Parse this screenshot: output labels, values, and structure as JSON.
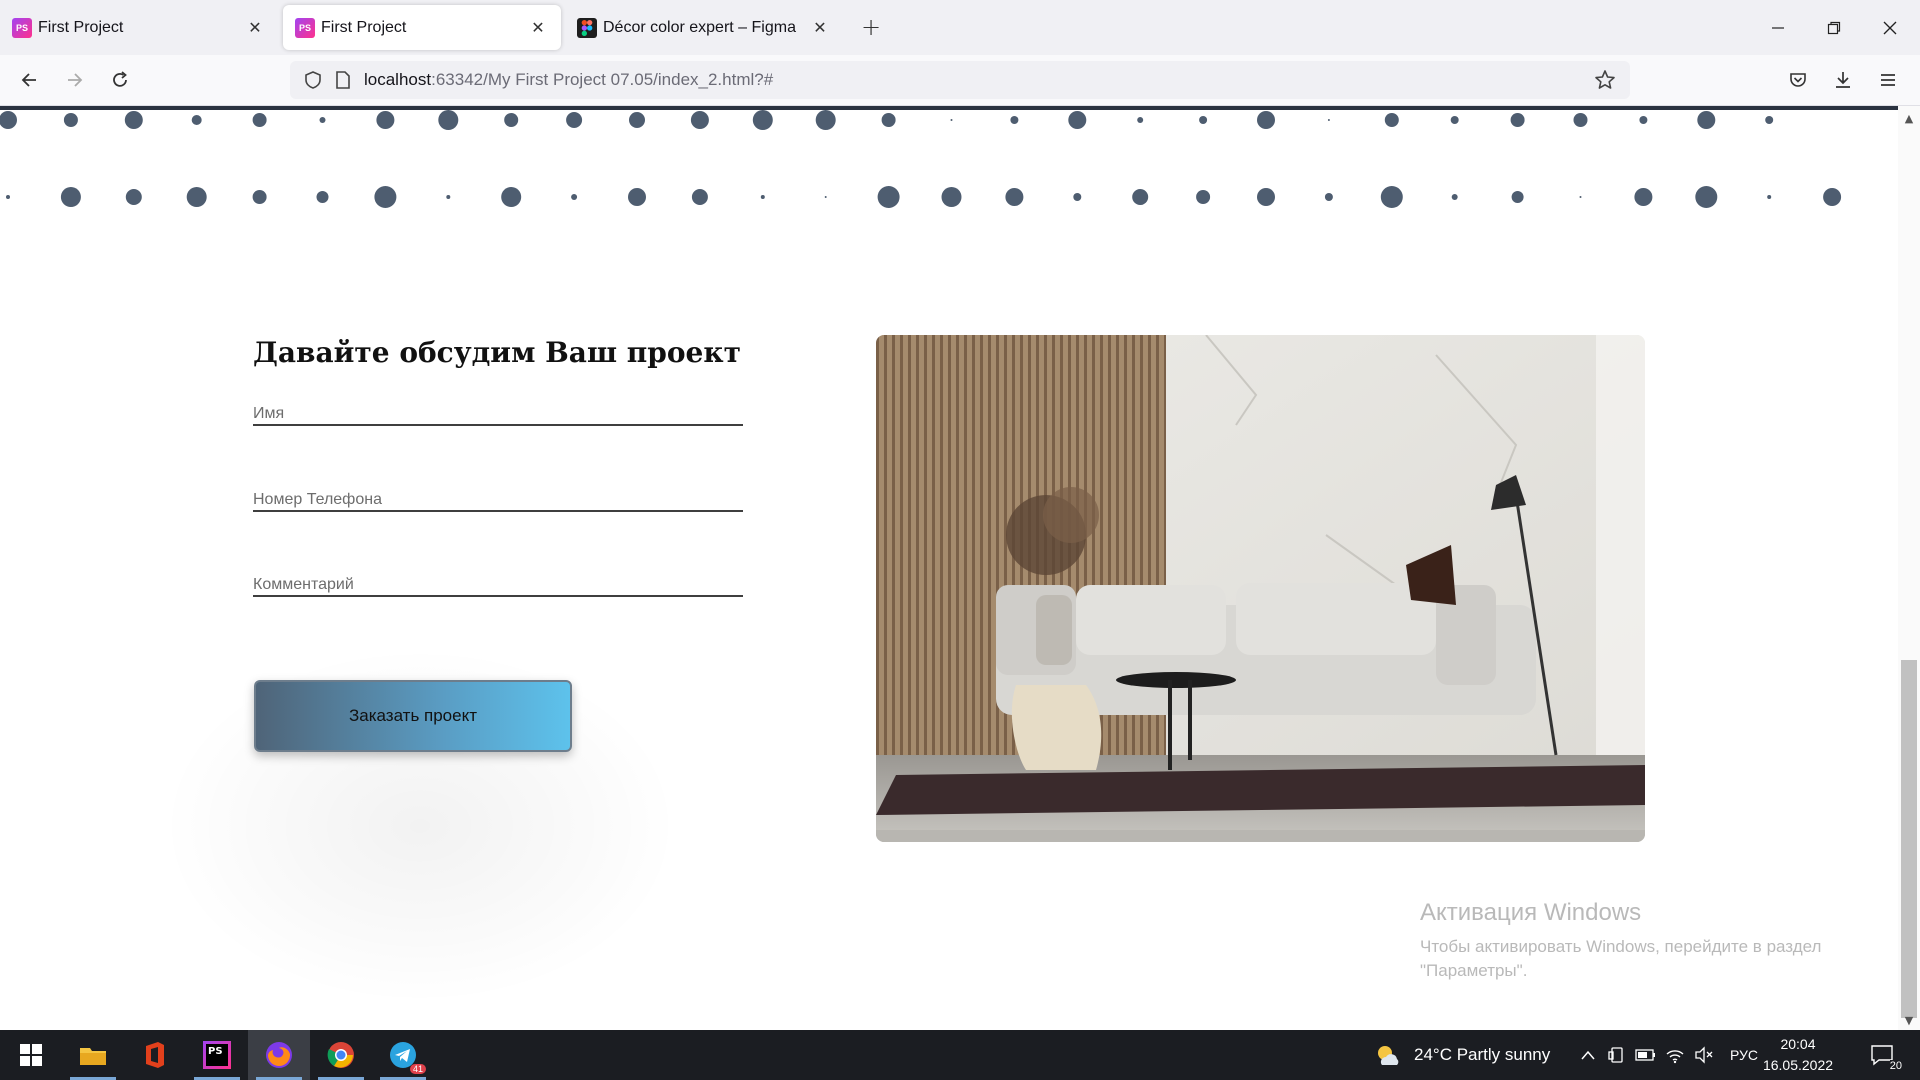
{
  "browser": {
    "tabs": [
      {
        "title": "First Project",
        "icon": "phpstorm-icon",
        "active": false
      },
      {
        "title": "First Project",
        "icon": "phpstorm-icon",
        "active": true
      },
      {
        "title": "Décor color expert – Figma",
        "icon": "figma-icon",
        "active": false
      }
    ],
    "url_host": "localhost",
    "url_rest": ":63342/My First Project 07.05/index_2.html?#"
  },
  "form": {
    "title": "Давайте обсудим Ваш проект",
    "fields": [
      {
        "label": "Имя"
      },
      {
        "label": "Номер Телефона"
      },
      {
        "label": "Комментарий"
      }
    ],
    "submit_label": "Заказать проект"
  },
  "photo": {
    "subject": "interior-living-room-photo"
  },
  "watermark": {
    "title": "Активация Windows",
    "line1": "Чтобы активировать Windows, перейдите в раздел",
    "line2": "\"Параметры\"."
  },
  "taskbar": {
    "apps": [
      "start-icon",
      "file-explorer-icon",
      "office-icon",
      "phpstorm-icon",
      "firefox-icon",
      "chrome-icon",
      "telegram-icon"
    ],
    "telegram_badge": "41",
    "weather": "24°C  Partly sunny",
    "language": "РУС",
    "time": "20:04",
    "date": "16.05.2022",
    "notifications": "20"
  },
  "colors": {
    "dots": "#4e5d70",
    "button_start": "#4f6478",
    "button_end": "#5dc2ec"
  }
}
